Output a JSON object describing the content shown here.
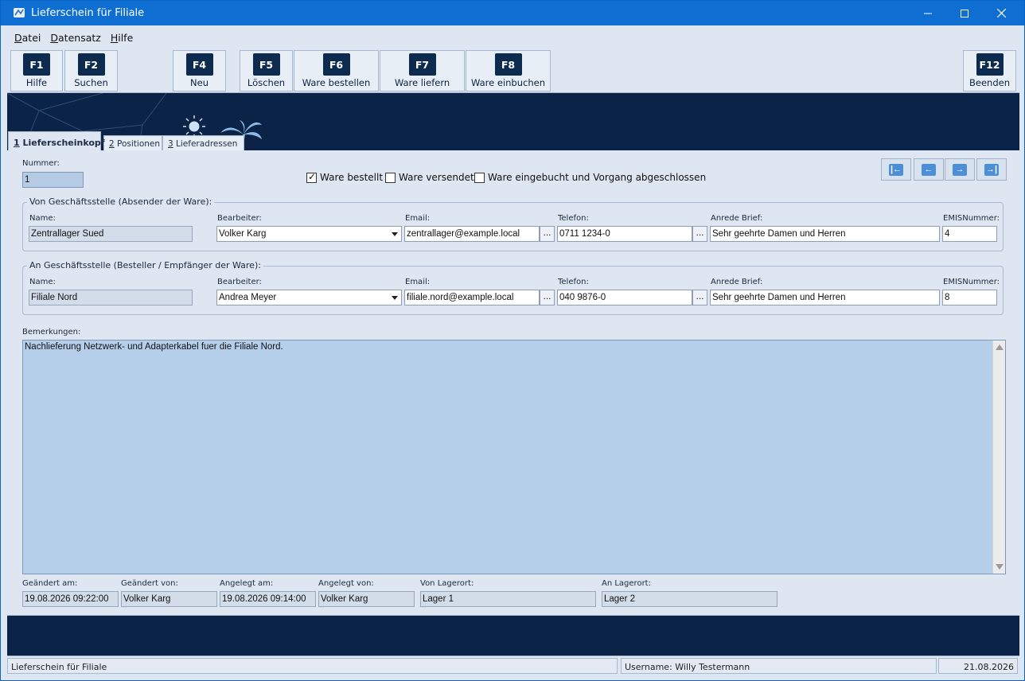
{
  "window": {
    "title": "Lieferschein für Filiale"
  },
  "menu": [
    "Datei",
    "Datensatz",
    "Hilfe"
  ],
  "toolbar": [
    {
      "key": "F1",
      "label": "Hilfe"
    },
    {
      "key": "F2",
      "label": "Suchen"
    },
    {
      "key": "F4",
      "label": "Neu"
    },
    {
      "key": "F5",
      "label": "Löschen"
    },
    {
      "key": "F6",
      "label": "Ware bestellen"
    },
    {
      "key": "F7",
      "label": "Ware liefern"
    },
    {
      "key": "F8",
      "label": "Ware einbuchen"
    },
    {
      "key": "F12",
      "label": "Beenden"
    }
  ],
  "tabs": [
    {
      "num": "1",
      "label": " Lieferscheinkopf"
    },
    {
      "num": "2",
      "label": " Positionen"
    },
    {
      "num": "3",
      "label": " Lieferadressen"
    }
  ],
  "header": {
    "nummer_label": "Nummer:",
    "nummer": "1",
    "checks": [
      {
        "label": "Ware bestellt",
        "checked": true
      },
      {
        "label": "Ware versendet",
        "checked": false
      },
      {
        "label": "Ware eingebucht und Vorgang abgeschlossen",
        "checked": false
      }
    ],
    "nav": [
      "first-record-icon",
      "previous-record-icon",
      "next-record-icon",
      "last-record-icon"
    ]
  },
  "labels": {
    "name": "Name:",
    "bearbeiter": "Bearbeiter:",
    "email": "Email:",
    "telefon": "Telefon:",
    "anrede": "Anrede Brief:",
    "emis": "EMISNummer:",
    "dots": "..."
  },
  "von": {
    "legend": "Von Geschäftsstelle (Absender der Ware):",
    "name": "Zentrallager Sued",
    "bearbeiter": "Volker Karg",
    "email": "zentrallager@example.local",
    "telefon": "0711 1234-0",
    "anrede": "Sehr geehrte Damen und Herren",
    "emis": "4"
  },
  "an": {
    "legend": "An Geschäftsstelle (Besteller / Empfänger der Ware):",
    "name": "Filiale Nord",
    "bearbeiter": "Andrea Meyer",
    "email": "filiale.nord@example.local",
    "telefon": "040 9876-0",
    "anrede": "Sehr geehrte Damen und Herren",
    "emis": "8"
  },
  "bemerkungen": {
    "label": "Bemerkungen:",
    "text": "Nachlieferung Netzwerk- und Adapterkabel fuer die Filiale Nord."
  },
  "footer": {
    "geaendert_am_label": "Geändert am:",
    "geaendert_am": "19.08.2026 09:22:00",
    "geaendert_von_label": "Geändert von:",
    "geaendert_von": "Volker Karg",
    "angelegt_am_label": "Angelegt am:",
    "angelegt_am": "19.08.2026 09:14:00",
    "angelegt_von_label": "Angelegt von:",
    "angelegt_von": "Volker Karg",
    "von_lagerort_label": "Von Lagerort:",
    "von_lagerort": "Lager 1",
    "an_lagerort_label": "An Lagerort:",
    "an_lagerort": "Lager 2"
  },
  "status": {
    "left": "Lieferschein für Filiale",
    "user": "Username: Willy Testermann",
    "date": "21.08.2026"
  },
  "colors": {
    "titlebar": "#0e6ed2",
    "dark_band": "#0b2346",
    "panel": "#dde6f1",
    "memo": "#b5cfea"
  }
}
